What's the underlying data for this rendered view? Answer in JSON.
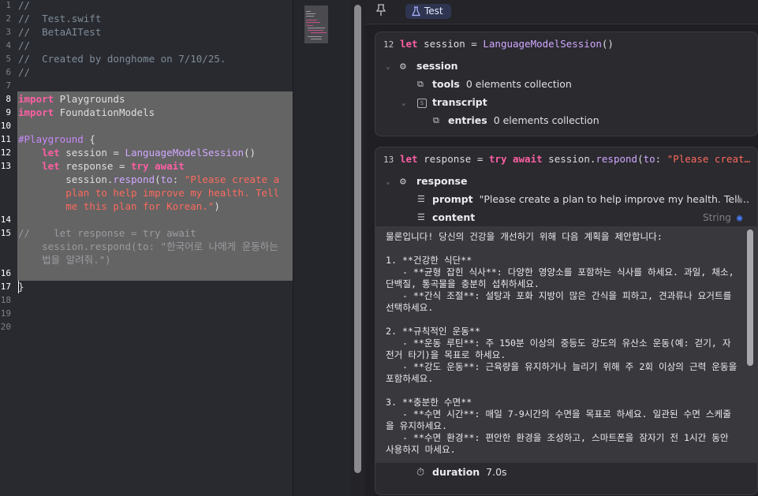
{
  "editor": {
    "lines": [
      {
        "n": "1",
        "segs": [
          {
            "t": "//",
            "c": "com"
          }
        ]
      },
      {
        "n": "2",
        "segs": [
          {
            "t": "//  Test.swift",
            "c": "com"
          }
        ]
      },
      {
        "n": "3",
        "segs": [
          {
            "t": "//  BetaAITest",
            "c": "com"
          }
        ]
      },
      {
        "n": "4",
        "segs": [
          {
            "t": "//",
            "c": "com"
          }
        ]
      },
      {
        "n": "5",
        "segs": [
          {
            "t": "//  Created by donghome on 7/10/25.",
            "c": "com"
          }
        ]
      },
      {
        "n": "6",
        "segs": [
          {
            "t": "//",
            "c": "com"
          }
        ]
      },
      {
        "n": "7",
        "segs": []
      },
      {
        "n": "8",
        "segs": [
          {
            "t": "import",
            "c": "kw"
          },
          {
            "t": " Playgrounds",
            "c": "id"
          }
        ]
      },
      {
        "n": "9",
        "segs": [
          {
            "t": "import",
            "c": "kw"
          },
          {
            "t": " FoundationModels",
            "c": "id"
          }
        ]
      },
      {
        "n": "10",
        "segs": []
      },
      {
        "n": "11",
        "segs": [
          {
            "t": "#Playground",
            "c": "mac"
          },
          {
            "t": " {",
            "c": "id"
          }
        ]
      },
      {
        "n": "12",
        "segs": [
          {
            "t": "    ",
            "c": "id"
          },
          {
            "t": "let",
            "c": "kw"
          },
          {
            "t": " session = ",
            "c": "id"
          },
          {
            "t": "LanguageModelSession",
            "c": "cls"
          },
          {
            "t": "()",
            "c": "id"
          }
        ]
      },
      {
        "n": "13",
        "segs": [
          {
            "t": "    ",
            "c": "id"
          },
          {
            "t": "let",
            "c": "kw"
          },
          {
            "t": " response = ",
            "c": "id"
          },
          {
            "t": "try",
            "c": "kw"
          },
          {
            "t": " ",
            "c": "id"
          },
          {
            "t": "await",
            "c": "kw"
          }
        ]
      },
      {
        "n": "",
        "segs": [
          {
            "t": "        session.",
            "c": "id"
          },
          {
            "t": "respond",
            "c": "cls"
          },
          {
            "t": "(",
            "c": "id"
          },
          {
            "t": "to",
            "c": "cls"
          },
          {
            "t": ": ",
            "c": "id"
          },
          {
            "t": "\"Please create a",
            "c": "str"
          }
        ]
      },
      {
        "n": "",
        "segs": [
          {
            "t": "        plan to help improve my health. Tell",
            "c": "str"
          }
        ]
      },
      {
        "n": "",
        "segs": [
          {
            "t": "        me this plan for Korean.\"",
            "c": "str"
          },
          {
            "t": ")",
            "c": "id"
          }
        ]
      },
      {
        "n": "14",
        "segs": []
      },
      {
        "n": "15",
        "segs": [
          {
            "t": "//    let response = try await",
            "c": "dim"
          }
        ]
      },
      {
        "n": "",
        "segs": [
          {
            "t": "    session.respond(to: \"한국어로 나에게 운동하는",
            "c": "dim"
          }
        ]
      },
      {
        "n": "",
        "segs": [
          {
            "t": "    법을 알려줘.\")",
            "c": "dim"
          }
        ]
      },
      {
        "n": "16",
        "segs": []
      },
      {
        "n": "17",
        "segs": [
          {
            "t": "}",
            "c": "id"
          }
        ]
      },
      {
        "n": "18",
        "segs": []
      },
      {
        "n": "19",
        "segs": []
      },
      {
        "n": "20",
        "segs": []
      }
    ]
  },
  "canvas": {
    "tab_label": "Test",
    "card1": {
      "line_number": "12",
      "code": [
        {
          "t": "let",
          "c": "kw"
        },
        {
          "t": " session = ",
          "c": "id"
        },
        {
          "t": "LanguageModelSession",
          "c": "cls"
        },
        {
          "t": "()",
          "c": "id"
        }
      ],
      "session_label": "session",
      "tools_label": "tools",
      "tools_value": "0 elements collection",
      "transcript_label": "transcript",
      "entries_label": "entries",
      "entries_value": "0 elements collection"
    },
    "card2": {
      "line_number": "13",
      "code": [
        {
          "t": "let",
          "c": "kw"
        },
        {
          "t": " response = ",
          "c": "id"
        },
        {
          "t": "try",
          "c": "kw"
        },
        {
          "t": " ",
          "c": "id"
        },
        {
          "t": "await",
          "c": "kw"
        },
        {
          "t": " session.",
          "c": "id"
        },
        {
          "t": "respond",
          "c": "cls"
        },
        {
          "t": "(",
          "c": "id"
        },
        {
          "t": "to",
          "c": "cls"
        },
        {
          "t": ": ",
          "c": "id"
        },
        {
          "t": "\"Please creat…",
          "c": "str"
        }
      ],
      "response_label": "response",
      "prompt_label": "prompt",
      "prompt_value": "\"Please create a plan to help improve my health. Tell...",
      "content_label": "content",
      "content_type": "String",
      "content_text": "물론입니다! 당신의 건강을 개선하기 위해 다음 계획을 제안합니다:\n\n1. **건강한 식단**\n   - **균형 잡힌 식사**: 다양한 영양소를 포함하는 식사를 하세요. 과일, 채소, 단백질, 통곡물을 충분히 섭취하세요.\n   - **간식 조절**: 설탕과 포화 지방이 많은 간식을 피하고, 견과류나 요거트를 선택하세요.\n\n2. **규칙적인 운동**\n   - **운동 루틴**: 주 150분 이상의 중등도 강도의 유산소 운동(예: 걷기, 자전거 타기)을 목표로 하세요.\n   - **강도 운동**: 근육량을 유지하거나 늘리기 위해 주 2회 이상의 근력 운동을 포함하세요.\n\n3. **충분한 수면**\n   - **수면 시간**: 매일 7-9시간의 수면을 목표로 하세요. 일관된 수면 스케줄을 유지하세요.\n   - **수면 환경**: 편안한 환경을 조성하고, 스마트폰을 잠자기 전 1시간 동안 사용하지 마세요.",
      "duration_label": "duration",
      "duration_value": "7.0s"
    }
  },
  "colors": {
    "keyword": "#fc5fa3",
    "string": "#fc6a5d",
    "type": "#d0a8ff",
    "comment": "#7f8c98",
    "eye_active": "#4a7dff"
  }
}
